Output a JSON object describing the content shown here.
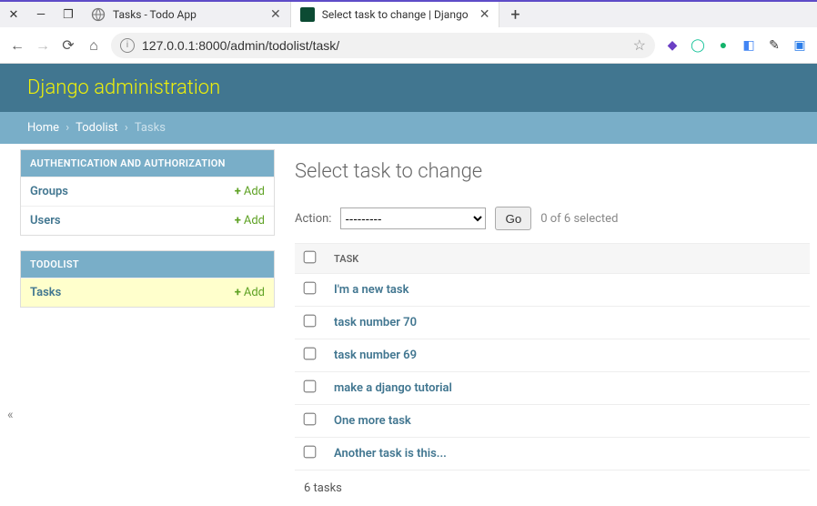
{
  "os": {
    "tabs": [
      {
        "title": "Tasks - Todo App"
      },
      {
        "title": "Select task to change | Django"
      }
    ],
    "newtab_glyph": "+"
  },
  "browser": {
    "url": "127.0.0.1:8000/admin/todolist/task/"
  },
  "header": {
    "brand": "Django administration"
  },
  "breadcrumbs": {
    "home": "Home",
    "app": "Todolist",
    "current": "Tasks",
    "sep": "›"
  },
  "sidebar": {
    "auth_header": "AUTHENTICATION AND AUTHORIZATION",
    "auth_items": [
      {
        "label": "Groups",
        "add": "Add"
      },
      {
        "label": "Users",
        "add": "Add"
      }
    ],
    "todolist_header": "TODOLIST",
    "todolist_items": [
      {
        "label": "Tasks",
        "add": "Add"
      }
    ],
    "plus_glyph": "+"
  },
  "main": {
    "heading": "Select task to change",
    "action_label": "Action:",
    "action_placeholder": "---------",
    "go_label": "Go",
    "selection_counter": "0 of 6 selected",
    "col_task": "TASK",
    "rows": [
      {
        "title": "I'm a new task"
      },
      {
        "title": "task number 70"
      },
      {
        "title": "task number 69"
      },
      {
        "title": "make a django tutorial"
      },
      {
        "title": "One more task"
      },
      {
        "title": "Another task is this..."
      }
    ],
    "paginator": "6 tasks"
  },
  "collapse_glyph": "«"
}
